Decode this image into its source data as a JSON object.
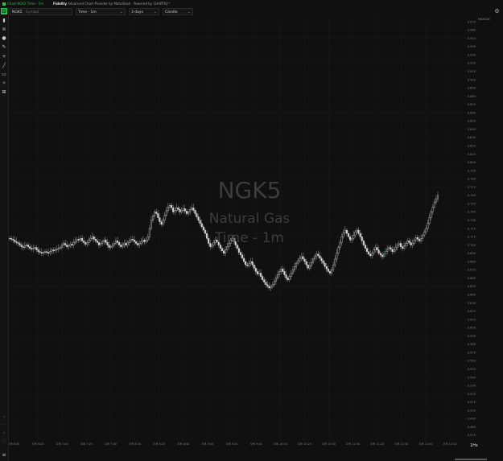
{
  "window": {
    "title": "Chart NGK5 Time - 1m",
    "provider_label": "Fidelity",
    "provider_desc": "Advanced Chart Provider by MetaStock",
    "powered": "Powered by CHARTIQ™"
  },
  "toolbar": {
    "symbol": "NGK5",
    "symbol_placeholder": "Symbol",
    "interval": "Time - 1m",
    "range": "3 days",
    "chart_type": "Candle"
  },
  "watermark": {
    "symbol": "NGK5",
    "name": "Natural Gas",
    "interval": "Time - 1m"
  },
  "scale_header": "MARGIN",
  "period_label": "1Hs",
  "left_tools": [
    "chart-icon",
    "layers-icon",
    "drop-icon",
    "magic-icon",
    "crosshair-icon",
    "line-icon",
    "rect-icon",
    "measure-icon",
    "settings-icon"
  ],
  "colors": {
    "up": "#2fbf4a",
    "down": "#d0d0d0",
    "bg": "#101010",
    "grid": "#1b1b1b"
  },
  "chart_data": {
    "type": "candle",
    "title": "",
    "y_ticks": [
      3.97,
      3.96,
      3.95,
      3.94,
      3.93,
      3.92,
      3.91,
      3.9,
      3.89,
      3.88,
      3.87,
      3.86,
      3.85,
      3.84,
      3.83,
      3.82,
      3.81,
      3.8,
      3.79,
      3.78,
      3.77,
      3.76,
      3.75,
      3.74,
      3.73,
      3.72,
      3.71,
      3.7,
      3.69,
      3.68,
      3.67,
      3.66,
      3.65,
      3.64,
      3.63,
      3.62,
      3.61,
      3.6,
      3.59,
      3.58,
      3.57,
      3.56,
      3.55,
      3.54,
      3.53,
      3.52,
      3.51,
      3.5,
      3.49,
      3.48,
      3.47
    ],
    "ylim": [
      3.466,
      3.972
    ],
    "x_tick_labels": [
      "오후 6:00",
      "오후 6:20",
      "오후 7:40",
      "오후 7:20",
      "오후 7:40",
      "오후 8:00",
      "오후 8:20",
      "오후 8:40",
      "오후 9:00",
      "오후 9:20",
      "오후 9:40",
      "오후 10:00",
      "오후 10:20",
      "오후 10:40",
      "오후 11:00",
      "오후 11:20",
      "오후 11:40",
      "오후 12:00",
      "오후 12:20"
    ],
    "price_series": [
      3.708,
      3.707,
      3.706,
      3.704,
      3.703,
      3.702,
      3.7,
      3.698,
      3.697,
      3.699,
      3.7,
      3.698,
      3.696,
      3.695,
      3.696,
      3.697,
      3.694,
      3.692,
      3.691,
      3.69,
      3.691,
      3.692,
      3.691,
      3.69,
      3.692,
      3.694,
      3.693,
      3.694,
      3.695,
      3.696,
      3.697,
      3.7,
      3.702,
      3.7,
      3.698,
      3.699,
      3.701,
      3.7,
      3.703,
      3.705,
      3.707,
      3.706,
      3.708,
      3.705,
      3.703,
      3.701,
      3.703,
      3.706,
      3.708,
      3.71,
      3.707,
      3.705,
      3.703,
      3.7,
      3.702,
      3.704,
      3.706,
      3.703,
      3.7,
      3.697,
      3.698,
      3.7,
      3.702,
      3.705,
      3.703,
      3.7,
      3.698,
      3.7,
      3.702,
      3.7,
      3.703,
      3.705,
      3.707,
      3.706,
      3.704,
      3.702,
      3.7,
      3.702,
      3.704,
      3.706,
      3.704,
      3.706,
      3.71,
      3.72,
      3.73,
      3.735,
      3.74,
      3.738,
      3.733,
      3.728,
      3.725,
      3.73,
      3.736,
      3.742,
      3.746,
      3.748,
      3.745,
      3.74,
      3.742,
      3.745,
      3.743,
      3.74,
      3.742,
      3.744,
      3.741,
      3.738,
      3.74,
      3.743,
      3.745,
      3.742,
      3.738,
      3.734,
      3.73,
      3.726,
      3.722,
      3.718,
      3.714,
      3.708,
      3.702,
      3.698,
      3.7,
      3.703,
      3.706,
      3.704,
      3.7,
      3.696,
      3.693,
      3.69,
      3.694,
      3.698,
      3.702,
      3.706,
      3.708,
      3.704,
      3.7,
      3.696,
      3.691,
      3.688,
      3.684,
      3.68,
      3.676,
      3.675,
      3.678,
      3.68,
      3.676,
      3.672,
      3.668,
      3.665,
      3.666,
      3.662,
      3.658,
      3.655,
      3.652,
      3.65,
      3.648,
      3.65,
      3.652,
      3.656,
      3.66,
      3.664,
      3.668,
      3.671,
      3.668,
      3.664,
      3.66,
      3.658,
      3.662,
      3.666,
      3.67,
      3.674,
      3.678,
      3.681,
      3.684,
      3.686,
      3.683,
      3.68,
      3.676,
      3.672,
      3.675,
      3.679,
      3.683,
      3.686,
      3.689,
      3.687,
      3.684,
      3.681,
      3.678,
      3.674,
      3.671,
      3.668,
      3.666,
      3.67,
      3.676,
      3.683,
      3.69,
      3.697,
      3.703,
      3.71,
      3.715,
      3.718,
      3.714,
      3.71,
      3.706,
      3.708,
      3.712,
      3.716,
      3.718,
      3.714,
      3.71,
      3.705,
      3.7,
      3.696,
      3.692,
      3.689,
      3.687,
      3.69,
      3.694,
      3.697,
      3.694,
      3.69,
      3.688,
      3.686,
      3.689,
      3.692,
      3.695,
      3.697,
      3.695,
      3.692,
      3.694,
      3.697,
      3.7,
      3.702,
      3.698,
      3.696,
      3.699,
      3.702,
      3.705,
      3.703,
      3.7,
      3.702,
      3.706,
      3.709,
      3.707,
      3.705,
      3.708,
      3.712,
      3.716,
      3.72,
      3.726,
      3.733,
      3.74,
      3.746,
      3.752,
      3.756,
      3.76
    ]
  }
}
